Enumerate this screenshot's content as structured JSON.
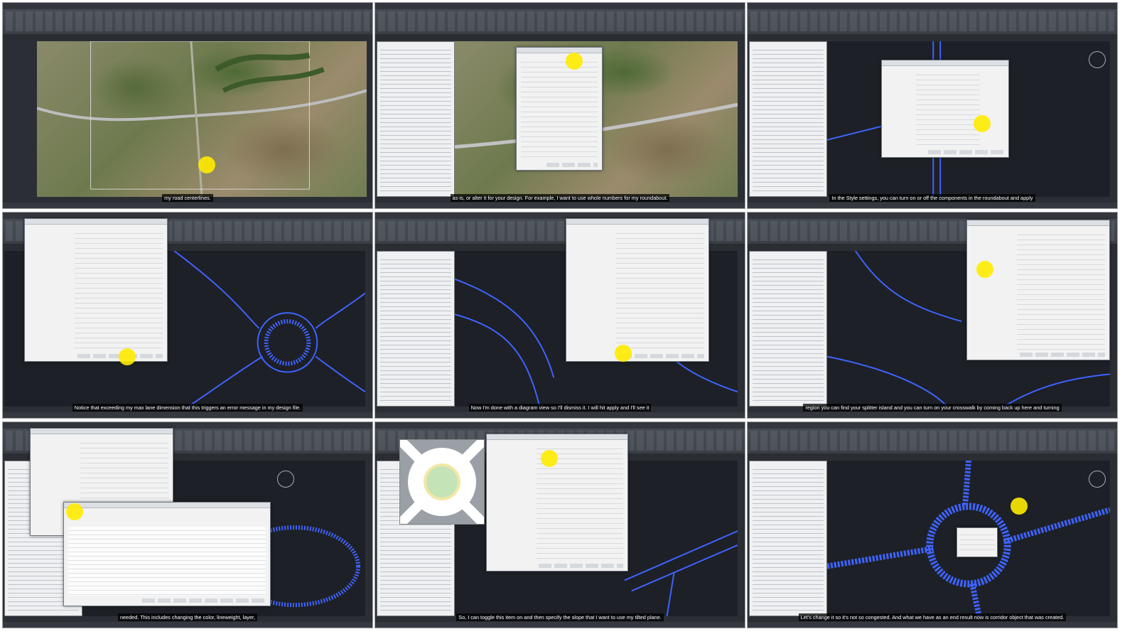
{
  "tiles": [
    {
      "caption": "my road centerlines."
    },
    {
      "caption": "as-is, or alter it for your design. For example, I want to use whole numbers for my roundabout."
    },
    {
      "caption": "In the Style settings, you can turn on or off the components in the roundabout and apply"
    },
    {
      "caption": "Notice that exceeding my max lane dimension that this triggers an error message in my design file."
    },
    {
      "caption": "Now I'm done with a diagram view so I'll dismiss it. I will hit apply and I'll see it"
    },
    {
      "caption": "region you can find your splitter island and you can turn on your crosswalk by coming back up here and turning"
    },
    {
      "caption": "needed. This includes changing the color, lineweight, layer,"
    },
    {
      "caption": "So, I can toggle this item on and then specify the slope that I want to use my tilted plane."
    },
    {
      "caption": "Let's change it so it's not so congested. And what we have as an end result now is corridor object that was created."
    }
  ],
  "colors": {
    "cad_background": "#1d2026",
    "linework": "#3f63ff",
    "cursor": "#ffeb00"
  }
}
